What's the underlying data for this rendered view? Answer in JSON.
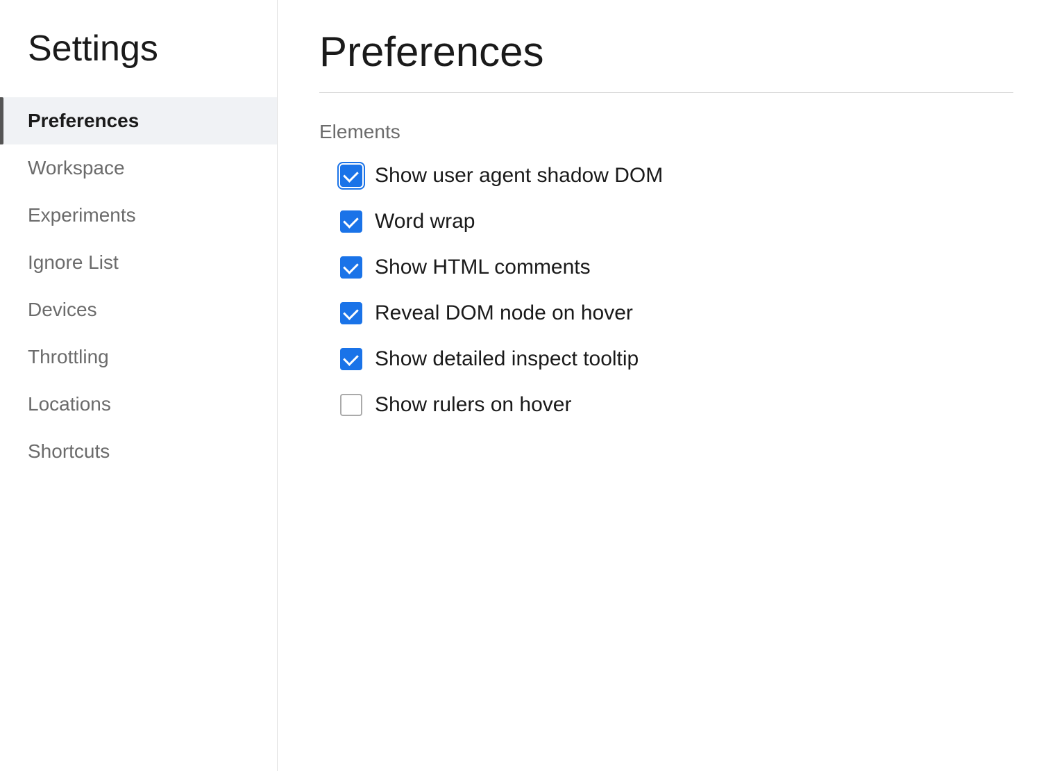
{
  "sidebar": {
    "title": "Settings",
    "nav_items": [
      {
        "id": "preferences",
        "label": "Preferences",
        "active": true
      },
      {
        "id": "workspace",
        "label": "Workspace",
        "active": false
      },
      {
        "id": "experiments",
        "label": "Experiments",
        "active": false
      },
      {
        "id": "ignore-list",
        "label": "Ignore List",
        "active": false
      },
      {
        "id": "devices",
        "label": "Devices",
        "active": false
      },
      {
        "id": "throttling",
        "label": "Throttling",
        "active": false
      },
      {
        "id": "locations",
        "label": "Locations",
        "active": false
      },
      {
        "id": "shortcuts",
        "label": "Shortcuts",
        "active": false
      }
    ]
  },
  "main": {
    "page_title": "Preferences",
    "sections": [
      {
        "id": "elements",
        "title": "Elements",
        "checkboxes": [
          {
            "id": "show-shadow-dom",
            "label": "Show user agent shadow DOM",
            "checked": true,
            "outline": true
          },
          {
            "id": "word-wrap",
            "label": "Word wrap",
            "checked": true,
            "outline": false
          },
          {
            "id": "show-html-comments",
            "label": "Show HTML comments",
            "checked": true,
            "outline": false
          },
          {
            "id": "reveal-dom-hover",
            "label": "Reveal DOM node on hover",
            "checked": true,
            "outline": false
          },
          {
            "id": "show-inspect-tooltip",
            "label": "Show detailed inspect tooltip",
            "checked": true,
            "outline": false
          },
          {
            "id": "show-rulers-hover",
            "label": "Show rulers on hover",
            "checked": false,
            "outline": false
          }
        ]
      }
    ]
  }
}
